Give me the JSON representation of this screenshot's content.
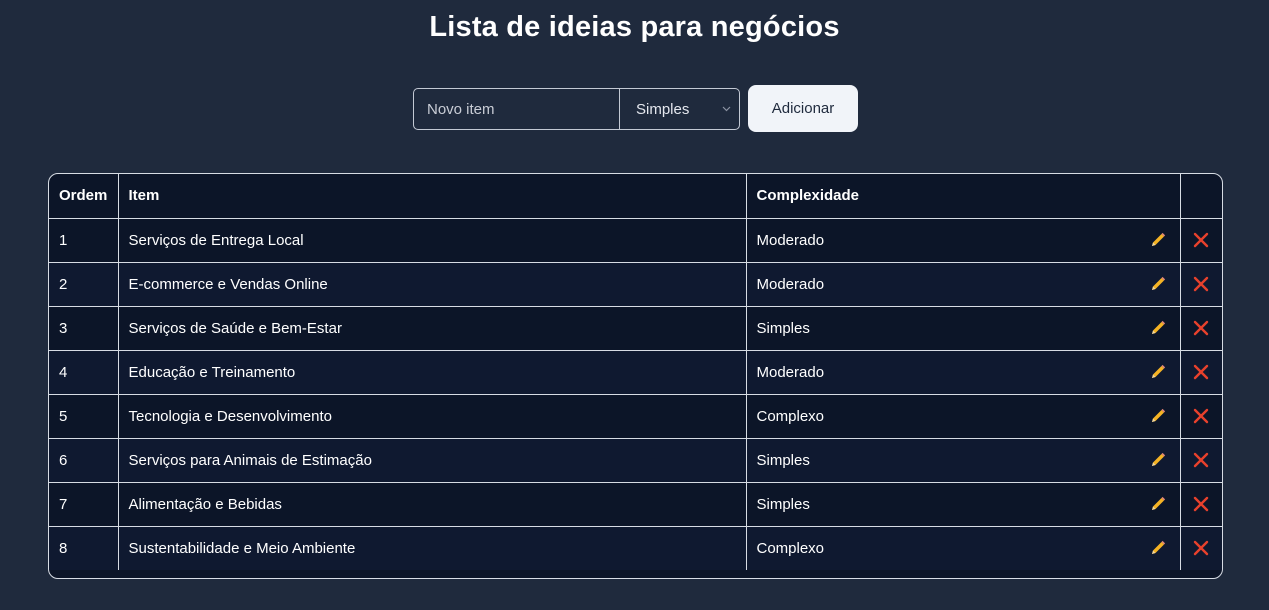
{
  "page": {
    "title": "Lista de ideias para negócios"
  },
  "form": {
    "item_placeholder": "Novo item",
    "item_value": "",
    "complexity_selected": "Simples",
    "add_label": "Adicionar"
  },
  "table": {
    "headers": {
      "order": "Ordem",
      "item": "Item",
      "complexity": "Complexidade",
      "actions": ""
    },
    "rows": [
      {
        "order": "1",
        "item": "Serviços de Entrega Local",
        "complexity": "Moderado"
      },
      {
        "order": "2",
        "item": "E-commerce e Vendas Online",
        "complexity": "Moderado"
      },
      {
        "order": "3",
        "item": "Serviços de Saúde e Bem-Estar",
        "complexity": "Simples"
      },
      {
        "order": "4",
        "item": "Educação e Treinamento",
        "complexity": "Moderado"
      },
      {
        "order": "5",
        "item": "Tecnologia e Desenvolvimento",
        "complexity": "Complexo"
      },
      {
        "order": "6",
        "item": "Serviços para Animais de Estimação",
        "complexity": "Simples"
      },
      {
        "order": "7",
        "item": "Alimentação e Bebidas",
        "complexity": "Simples"
      },
      {
        "order": "8",
        "item": "Sustentabilidade e Meio Ambiente",
        "complexity": "Complexo"
      }
    ]
  },
  "icons": {
    "edit": "pencil-icon",
    "delete": "cross-mark-icon",
    "select": "chevron-down-icon"
  },
  "colors": {
    "background": "#1f2a3d",
    "table_background": "#0c1528",
    "button_background": "#f1f4f9",
    "edit_icon": "#f5b324",
    "delete_icon": "#e8412c"
  }
}
